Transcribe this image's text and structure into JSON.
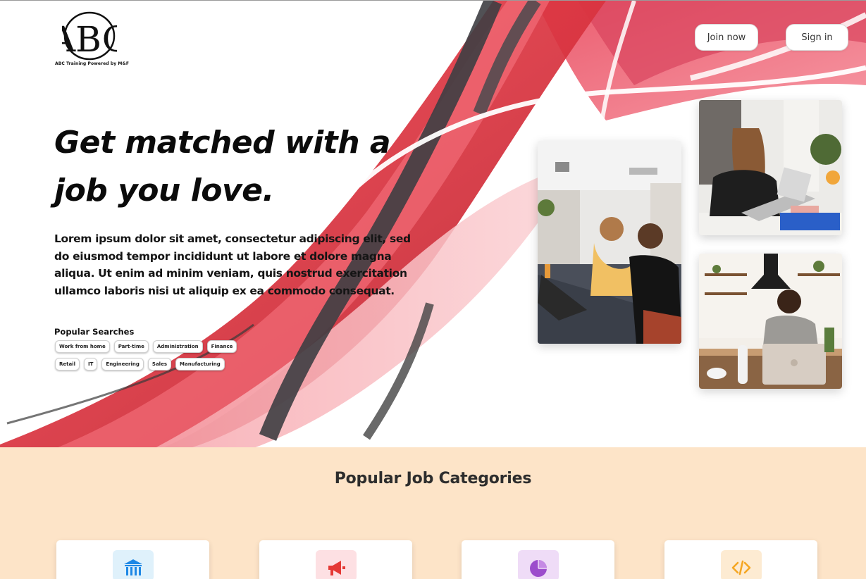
{
  "logo": {
    "mark": "ABC",
    "caption": "ABC Training Powered by M&F"
  },
  "nav": {
    "join_label": "Join now",
    "signin_label": "Sign in"
  },
  "hero": {
    "headline_line1": "Get matched with a",
    "headline_line2": "job you love.",
    "lede": "Lorem ipsum dolor sit amet, consectetur adipiscing elit, sed do eiusmod tempor incididunt ut labore et dolore magna aliqua. Ut enim ad minim veniam, quis nostrud exercitation ullamco laboris nisi ut aliquip ex ea commodo consequat.",
    "popular_title": "Popular Searches",
    "tags_row1": [
      "Work from home",
      "Part-time",
      "Administration",
      "Finance"
    ],
    "tags_row2": [
      "Retail",
      "IT",
      "Engineering",
      "Sales",
      "Manufacturing"
    ]
  },
  "categories": {
    "title": "Popular Job Categories",
    "cards": [
      {
        "icon": "bank-icon",
        "accent": "#1e88e5",
        "bg": "#dff1fb"
      },
      {
        "icon": "megaphone-icon",
        "accent": "#e53935",
        "bg": "#fde0e3"
      },
      {
        "icon": "pie-chart-icon",
        "accent": "#9c4dcc",
        "bg": "#efdcf7"
      },
      {
        "icon": "code-icon",
        "accent": "#f5a623",
        "bg": "#fdebd2"
      }
    ]
  },
  "colors": {
    "accent_red": "#e8404d",
    "peach_band": "#fde4c8"
  }
}
